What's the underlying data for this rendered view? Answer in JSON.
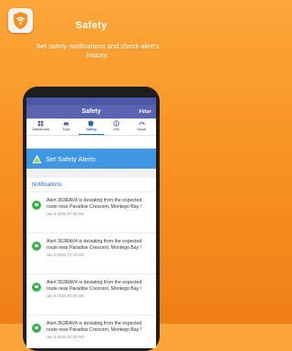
{
  "promo": {
    "title": "Safety",
    "subtitle": "Set safety notifications and check alert's history."
  },
  "appbar": {
    "title": "Safety",
    "filter_label": "Filter"
  },
  "tabs": [
    {
      "label": "Dashboard",
      "icon": "dashboard-icon"
    },
    {
      "label": "Trips",
      "icon": "car-icon"
    },
    {
      "label": "Safety",
      "icon": "shield-icon",
      "active": true
    },
    {
      "label": "Info",
      "icon": "info-icon"
    },
    {
      "label": "Score",
      "icon": "speedometer-icon"
    }
  ],
  "banner": {
    "label": "Set Safety Alerts"
  },
  "notifications": {
    "title": "Notifications",
    "items": [
      {
        "message": "Alert 363RAV4 is deviating from the expected route near Paradise Crescent, Montego Bay !",
        "time": "Jan 5 2018, 07:30 AM"
      },
      {
        "message": "Alert 363RAV4 is deviating from the expected route near Paradise Crescent, Montego Bay !",
        "time": "Jan 5 2018, 07:10 AM"
      },
      {
        "message": "Alert 363RAV4 is deviating from the expected route near Paradise Crescent, Montego Bay !",
        "time": "Jan 5 2018, 07:30 AM"
      },
      {
        "message": "Alert 363RAV4 is deviating from the expected route near Paradise Crescent, Montego Bay !",
        "time": "Jan 5 2018, 07:30 AM"
      }
    ]
  },
  "colors": {
    "background": "#f7901f",
    "appbar": "#5a63b0",
    "banner": "#3f97e3",
    "accent": "#2a64b3",
    "alert_dot": "#35b34a"
  }
}
